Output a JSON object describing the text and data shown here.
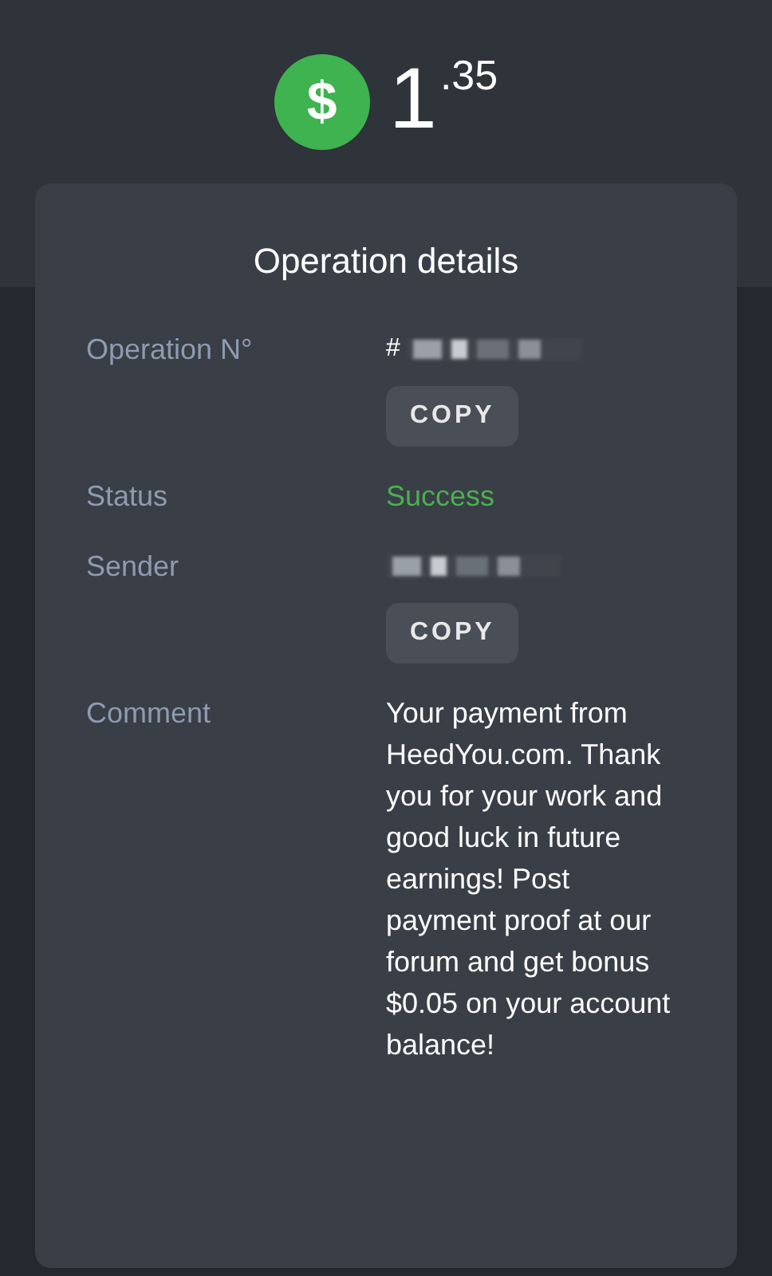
{
  "balance": {
    "currency_symbol": "$",
    "amount_main": "1",
    "amount_fraction": ".35"
  },
  "card": {
    "title": "Operation details",
    "rows": [
      {
        "kind": "redacted",
        "label": "Operation N°",
        "value": "#",
        "copy": "COPY"
      },
      {
        "kind": "status",
        "label": "Status",
        "value": "Success",
        "color": "#4caf50"
      },
      {
        "kind": "redacted",
        "label": "Sender",
        "value": "",
        "copy": "COPY"
      },
      {
        "kind": "text",
        "label": "Comment",
        "value": "Your payment from HeedYou.com. Thank you for your work and good luck in future earnings! Post payment proof at our forum and get bonus $0.05 on your account balance!"
      }
    ]
  }
}
